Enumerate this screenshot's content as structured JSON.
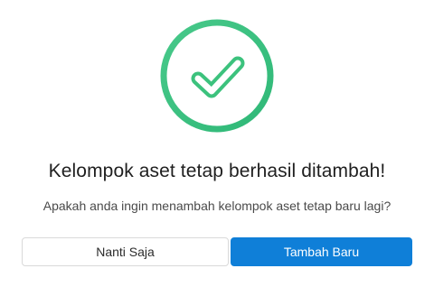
{
  "dialog": {
    "icon": "check-circle-icon",
    "accent_color": "#3cc27d",
    "title": "Kelompok aset tetap berhasil ditambah!",
    "message": "Apakah anda ingin menambah kelompok aset tetap baru lagi?",
    "buttons": {
      "secondary_label": "Nanti Saja",
      "primary_label": "Tambah Baru",
      "primary_color": "#0f7fd8"
    }
  }
}
